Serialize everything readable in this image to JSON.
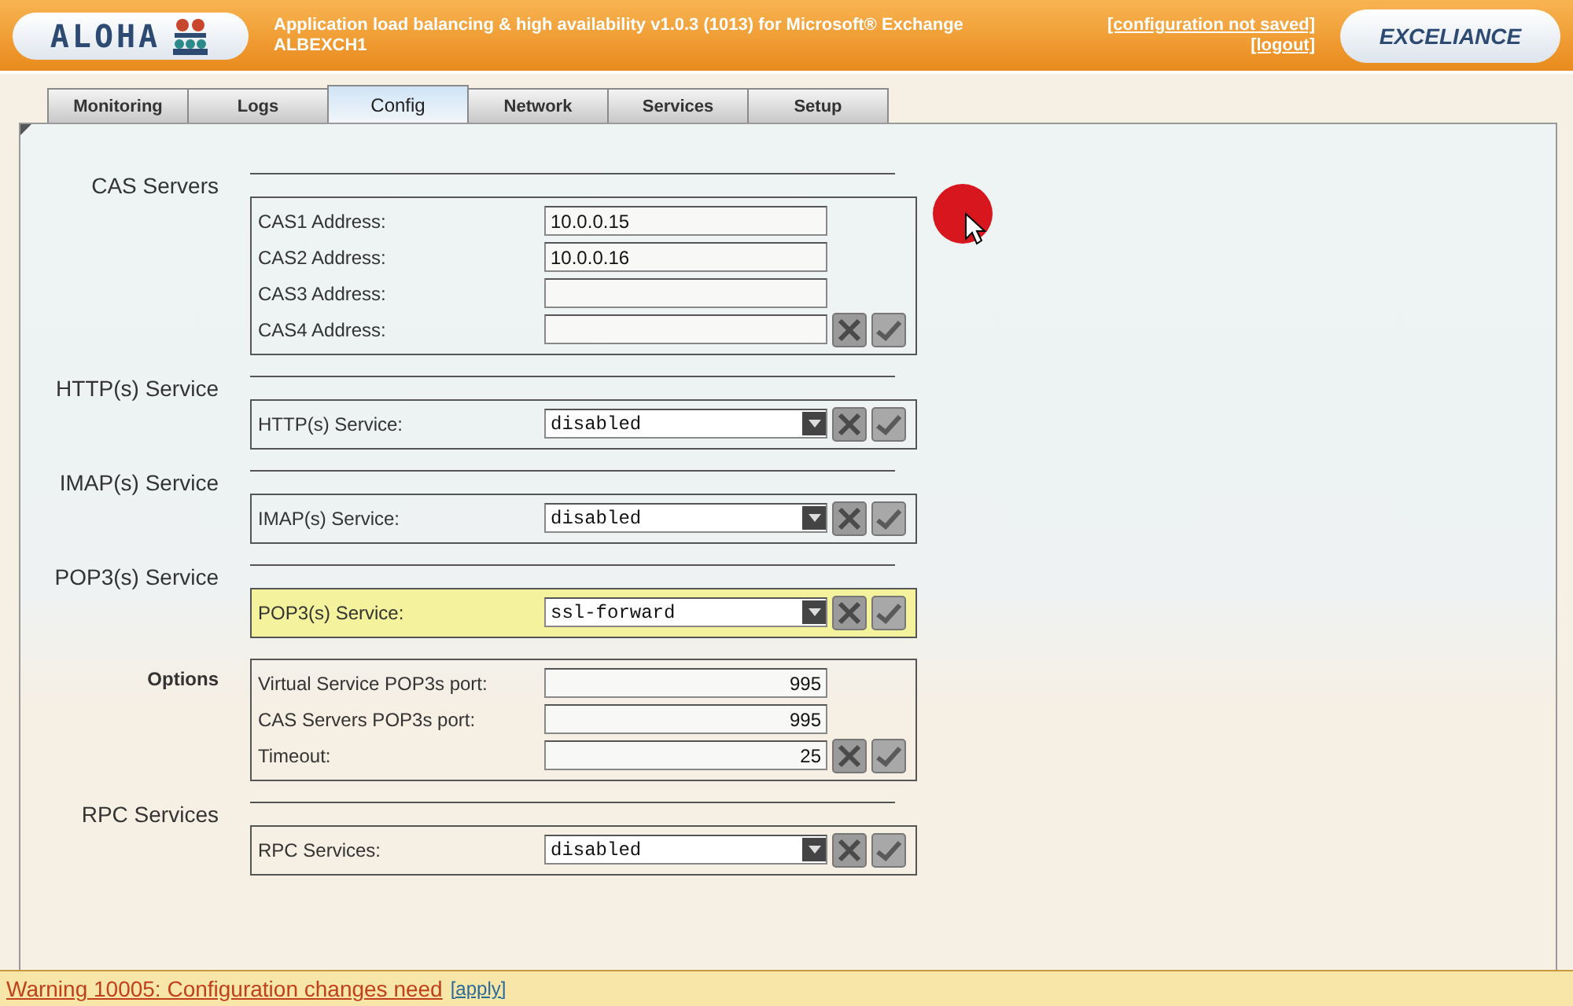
{
  "header": {
    "logo": "ALOHA",
    "title": "Application load balancing & high availability v1.0.3 (1013) for Microsoft® Exchange",
    "hostname": "ALBEXCH1",
    "links": [
      "[configuration not saved]",
      "[logout]"
    ],
    "brand": "EXCELIANCE"
  },
  "tabs": [
    {
      "label": "Monitoring",
      "selected": false
    },
    {
      "label": "Logs",
      "selected": false
    },
    {
      "label": "Config",
      "selected": true
    },
    {
      "label": "Network",
      "selected": false
    },
    {
      "label": "Services",
      "selected": false
    },
    {
      "label": "Setup",
      "selected": false
    }
  ],
  "sections": [
    {
      "kind": "section",
      "label": "CAS Servers",
      "highlighted": false,
      "rows": [
        {
          "kind": "text",
          "label": "CAS1 Address:",
          "value": "10.0.0.15",
          "actions": false
        },
        {
          "kind": "text",
          "label": "CAS2 Address:",
          "value": "10.0.0.16",
          "actions": false
        },
        {
          "kind": "text",
          "label": "CAS3 Address:",
          "actions": false
        },
        {
          "kind": "text",
          "label": "CAS4 Address:",
          "actions": true
        }
      ]
    },
    {
      "kind": "section",
      "label": "HTTP(s) Service",
      "highlighted": false,
      "rows": [
        {
          "kind": "select",
          "label": "HTTP(s) Service:",
          "value": "disabled",
          "actions": true
        }
      ]
    },
    {
      "kind": "section",
      "label": "IMAP(s) Service",
      "highlighted": false,
      "rows": [
        {
          "kind": "select",
          "label": "IMAP(s) Service:",
          "value": "disabled",
          "actions": true
        }
      ]
    },
    {
      "kind": "section",
      "label": "POP3(s) Service",
      "highlighted": true,
      "rows": [
        {
          "kind": "select",
          "label": "POP3(s) Service:",
          "value": "ssl-forward",
          "actions": true
        }
      ]
    },
    {
      "kind": "subsection",
      "label": "Options",
      "highlighted": false,
      "rows": [
        {
          "kind": "number",
          "label": "Virtual Service POP3s port:",
          "value": "995",
          "actions": false
        },
        {
          "kind": "number",
          "label": "CAS Servers POP3s port:",
          "value": "995",
          "actions": false
        },
        {
          "kind": "number",
          "label": "Timeout:",
          "value": "25",
          "actions": true
        }
      ]
    },
    {
      "kind": "section",
      "label": "RPC Services",
      "highlighted": false,
      "rows": [
        {
          "kind": "select",
          "label": "RPC Services:",
          "value": "disabled",
          "actions": true
        }
      ]
    }
  ],
  "warning": {
    "message": "Warning 10005: Configuration changes need",
    "link": "[apply]"
  }
}
